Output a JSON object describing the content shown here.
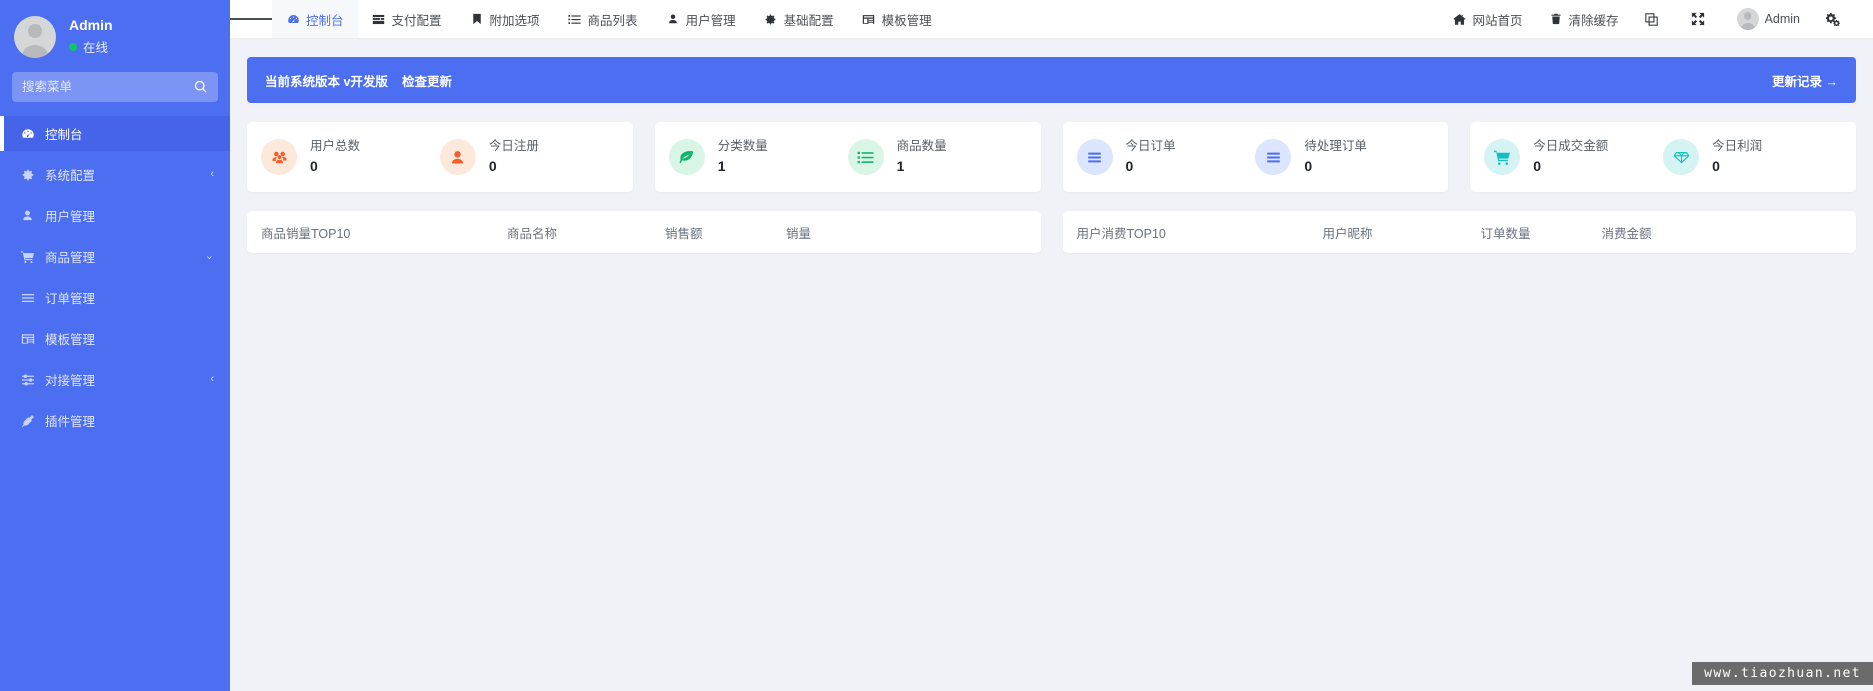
{
  "sidebar": {
    "profile": {
      "name": "Admin",
      "status": "在线",
      "status_color": "#15c26b",
      "avatar_icon": "user-avatar"
    },
    "search": {
      "placeholder": "搜索菜单",
      "value": "",
      "icon": "search-icon"
    },
    "items": [
      {
        "label": "控制台",
        "icon": "dashboard-icon",
        "active": true,
        "arrow": ""
      },
      {
        "label": "系统配置",
        "icon": "gear-icon",
        "active": false,
        "arrow": "‹"
      },
      {
        "label": "用户管理",
        "icon": "user-icon",
        "active": false,
        "arrow": ""
      },
      {
        "label": "商品管理",
        "icon": "cart-icon",
        "active": false,
        "arrow": "⌄"
      },
      {
        "label": "订单管理",
        "icon": "list-icon",
        "active": false,
        "arrow": ""
      },
      {
        "label": "模板管理",
        "icon": "template-icon",
        "active": false,
        "arrow": ""
      },
      {
        "label": "对接管理",
        "icon": "sliders-icon",
        "active": false,
        "arrow": "‹"
      },
      {
        "label": "插件管理",
        "icon": "plug-icon",
        "active": false,
        "arrow": ""
      }
    ]
  },
  "topbar": {
    "menu_toggle_icon": "hamburger-icon",
    "tabs": [
      {
        "label": "控制台",
        "icon": "dashboard-icon",
        "active": true
      },
      {
        "label": "支付配置",
        "icon": "payment-icon",
        "active": false
      },
      {
        "label": "附加选项",
        "icon": "bookmark-icon",
        "active": false
      },
      {
        "label": "商品列表",
        "icon": "list-icon",
        "active": false
      },
      {
        "label": "用户管理",
        "icon": "user-icon",
        "active": false
      },
      {
        "label": "基础配置",
        "icon": "gear-icon",
        "active": false
      },
      {
        "label": "模板管理",
        "icon": "template-icon",
        "active": false
      }
    ],
    "right": [
      {
        "label": "网站首页",
        "icon": "home-icon"
      },
      {
        "label": "清除缓存",
        "icon": "trash-icon"
      },
      {
        "label": "",
        "icon": "clone-icon"
      },
      {
        "label": "",
        "icon": "fullscreen-icon"
      },
      {
        "label": "Admin",
        "icon": "user-avatar"
      },
      {
        "label": "",
        "icon": "settings-cogs-icon"
      }
    ]
  },
  "version_bar": {
    "text": "当前系统版本 v开发版",
    "check_update": "检查更新",
    "changelog": "更新记录 →",
    "bg_color": "#4c6ef0"
  },
  "stat_cards": [
    {
      "stats": [
        {
          "label": "用户总数",
          "value": "0",
          "icon": "users-group-icon",
          "icon_color": "#fc5b26",
          "icon_bg": "#fde8dc"
        },
        {
          "label": "今日注册",
          "value": "0",
          "icon": "user-solid-icon",
          "icon_color": "#fc5b26",
          "icon_bg": "#fde8dc"
        }
      ]
    },
    {
      "stats": [
        {
          "label": "分类数量",
          "value": "1",
          "icon": "leaf-icon",
          "icon_color": "#13b46e",
          "icon_bg": "#d9f5e5"
        },
        {
          "label": "商品数量",
          "value": "1",
          "icon": "list-alt-icon",
          "icon_color": "#13b46e",
          "icon_bg": "#d9f5e5"
        }
      ]
    },
    {
      "stats": [
        {
          "label": "今日订单",
          "value": "0",
          "icon": "bars-icon",
          "icon_color": "#4c6ef0",
          "icon_bg": "#dbe5fd"
        },
        {
          "label": "待处理订单",
          "value": "0",
          "icon": "bars-icon",
          "icon_color": "#4c6ef0",
          "icon_bg": "#dbe5fd"
        }
      ]
    },
    {
      "stats": [
        {
          "label": "今日成交金额",
          "value": "0",
          "icon": "cart-icon",
          "icon_color": "#17bfbf",
          "icon_bg": "#d6f3f3"
        },
        {
          "label": "今日利润",
          "value": "0",
          "icon": "diamond-icon",
          "icon_color": "#17bfbf",
          "icon_bg": "#d6f3f3"
        }
      ]
    }
  ],
  "tables": [
    {
      "headers": [
        "商品销量TOP10",
        "商品名称",
        "销售额",
        "销量"
      ],
      "rows": []
    },
    {
      "headers": [
        "用户消费TOP10",
        "用户昵称",
        "订单数量",
        "消费金额"
      ],
      "rows": []
    }
  ],
  "watermark": {
    "text": "www.tiaozhuan.net"
  }
}
